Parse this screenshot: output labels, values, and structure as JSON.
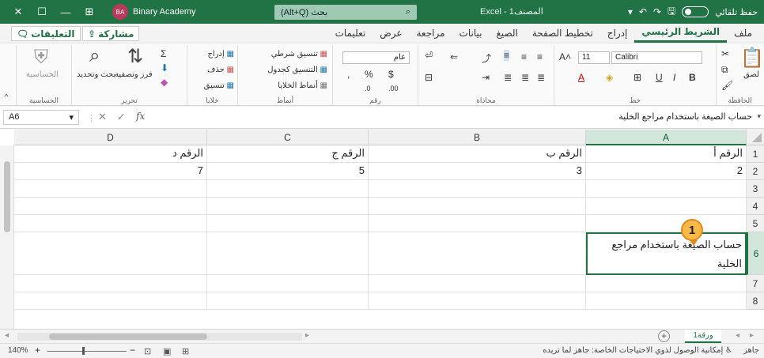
{
  "titlebar": {
    "user_initials": "BA",
    "user_name": "Binary Academy",
    "search_label": "(Alt+Q) بحث",
    "workbook_title": "Excel - المصنف1",
    "autosave_label": "حفظ تلقائي"
  },
  "tabs": [
    "ملف",
    "الشريط الرئيسي",
    "إدراج",
    "تخطيط الصفحة",
    "الصيغ",
    "بيانات",
    "مراجعة",
    "عرض",
    "تعليمات"
  ],
  "share_label": "مشاركة",
  "comments_label": "التعليقات",
  "ribbon": {
    "clipboard": {
      "label": "الحافظة",
      "paste": "لصق"
    },
    "font": {
      "label": "خط",
      "name": "Calibri",
      "size": "11"
    },
    "alignment": {
      "label": "محاذاة"
    },
    "number": {
      "label": "رقم",
      "format": "عام"
    },
    "styles": {
      "label": "أنماط",
      "conditional": "تنسيق شرطي",
      "as_table": "التنسيق كجدول",
      "cell_styles": "أنماط الخلايا"
    },
    "cells": {
      "label": "خلايا",
      "insert": "إدراج",
      "delete": "حذف",
      "format": "تنسيق"
    },
    "editing": {
      "label": "تحرير",
      "sort": "فرز وتصفية",
      "find": "بحث وتحديد"
    },
    "analysis": {
      "label": "الحساسية",
      "btn": "الحساسية"
    }
  },
  "formula_bar": {
    "name_box": "A6",
    "fx": "fx",
    "formula": "حساب الصيغة باستخدام مراجع الخلية"
  },
  "grid": {
    "columns": [
      "A",
      "B",
      "C",
      "D"
    ],
    "rows": [
      "1",
      "2",
      "3",
      "4",
      "5",
      "6",
      "7",
      "8"
    ],
    "cells": {
      "A1": "الرقم أ",
      "B1": "الرقم ب",
      "C1": "الرقم ج",
      "D1": "الرقم د",
      "A2": "2",
      "B2": "3",
      "C2": "5",
      "D2": "7",
      "A6": "حساب الصيغة باستخدام مراجع الخلية"
    }
  },
  "callout": "1",
  "sheet": {
    "tab_name": "ورقة1",
    "add": "+"
  },
  "status": {
    "ready": "جاهز",
    "accessibility": "إمكانية الوصول لذوي الاحتياجات الخاصة: جاهز لما تريده",
    "zoom": "140%"
  },
  "colors": {
    "accent": "#217346",
    "callout": "#f8b94a"
  }
}
